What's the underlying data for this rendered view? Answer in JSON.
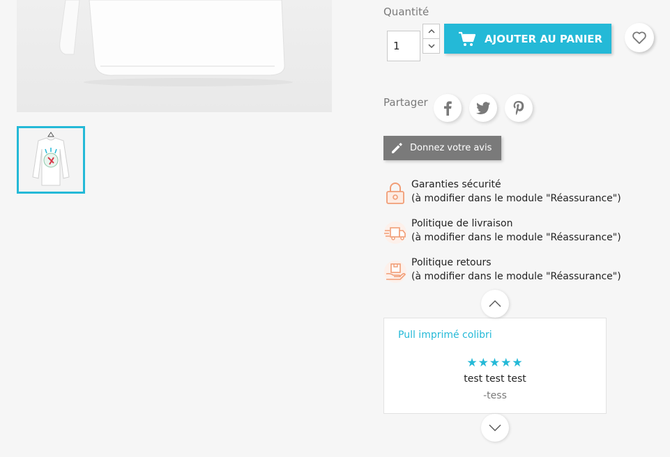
{
  "quantity": {
    "label": "Quantité",
    "value": "1"
  },
  "cart": {
    "add_label": "AJOUTER AU PANIER",
    "icon": "shopping-cart-icon"
  },
  "wishlist": {
    "icon": "heart-outline-icon"
  },
  "share": {
    "label": "Partager",
    "networks": [
      "facebook",
      "twitter",
      "pinterest"
    ]
  },
  "review_button": {
    "label": "Donnez votre avis",
    "icon": "pencil-icon"
  },
  "reassurance": [
    {
      "icon": "padlock-icon",
      "title": "Garanties sécurité",
      "desc": "(à modifier dans le module \"Réassurance\")"
    },
    {
      "icon": "delivery-truck-icon",
      "title": "Politique de livraison",
      "desc": "(à modifier dans le module \"Réassurance\")"
    },
    {
      "icon": "return-package-icon",
      "title": "Politique retours",
      "desc": "(à modifier dans le module \"Réassurance\")"
    }
  ],
  "review_carousel": {
    "product_title": "Pull imprimé colibri",
    "rating": 5,
    "stars": "★★★★★",
    "comment": "test test test",
    "author": "-tess"
  },
  "colors": {
    "accent": "#24b9d7",
    "grey_button": "#7a7a7a",
    "reassure_icon": "#f19d76"
  }
}
